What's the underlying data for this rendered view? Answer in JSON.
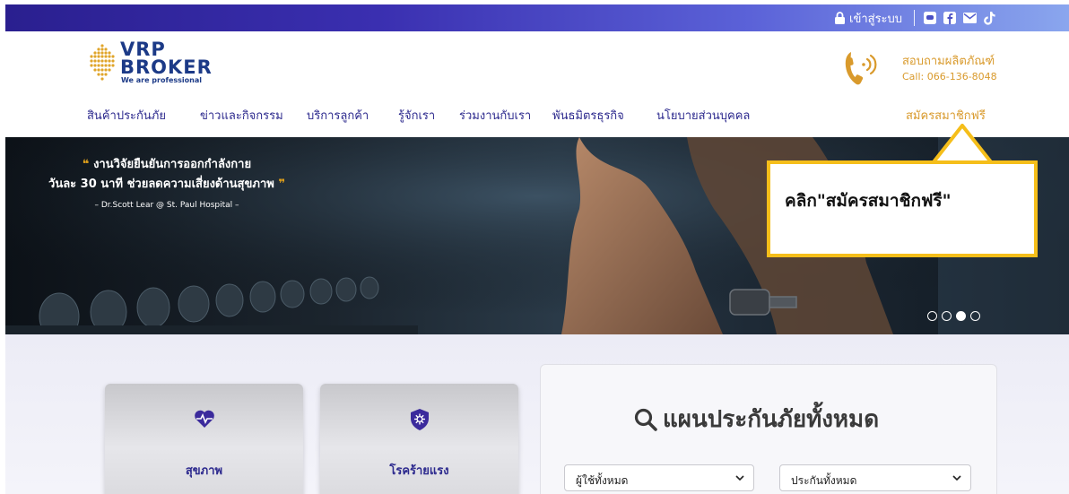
{
  "topbar": {
    "login_label": "เข้าสู่ระบบ",
    "social_icons": [
      "line-icon",
      "facebook-icon",
      "email-icon",
      "tiktok-icon"
    ]
  },
  "logo": {
    "line1": "VRP",
    "line2": "BROKER",
    "tagline": "We are professional"
  },
  "contact": {
    "title": "สอบถามผลิตภัณฑ์",
    "phone": "Call: 066-136-8048"
  },
  "nav": {
    "items": [
      "สินค้าประกันภัย",
      "ข่าวและกิจกรรม",
      "บริการลูกค้า",
      "รู้จักเรา",
      "ร่วมงานกับเรา",
      "พันธมิตรธุรกิจ",
      "นโยบายส่วนบุคคล"
    ],
    "signup": "สมัครสมาชิกฟรี"
  },
  "hero": {
    "quote_line1": "งานวิจัยยืนยันการออกกำลังกาย",
    "quote_line2": "วันละ 30 นาที ช่วยลดความเสี่ยงด้านสุขภาพ",
    "quote_cite": "– Dr.Scott Lear @ St. Paul Hospital –",
    "slides_total": 4,
    "active_slide": 3
  },
  "callout": {
    "text": "คลิก\"สมัครสมาชิกฟรี\""
  },
  "cards": [
    {
      "label": "สุขภาพ",
      "icon": "heart-pulse-icon"
    },
    {
      "label": "โรคร้ายแรง",
      "icon": "shield-virus-icon"
    }
  ],
  "plans": {
    "title": "แผนประกันภัยทั้งหมด",
    "filter_users": "ผู้ใช้ทั้งหมด",
    "filter_insurance": "ประกันทั้งหมด"
  },
  "colors": {
    "brand": "#2d2a8e",
    "accent": "#d99a2c",
    "callout_border": "#f5be1a"
  }
}
